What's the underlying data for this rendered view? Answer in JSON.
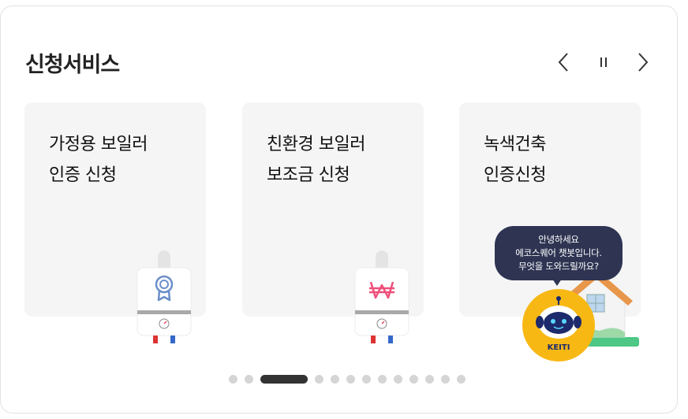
{
  "section": {
    "title": "신청서비스",
    "prev_icon": "chevron-left-icon",
    "pause_icon": "pause-icon",
    "next_icon": "chevron-right-icon"
  },
  "cards": [
    {
      "line1": "가정용 보일러",
      "line2": "인증 신청",
      "icon": "certification-ribbon-icon",
      "icon_color": "#6c8fc9"
    },
    {
      "line1": "친환경 보일러",
      "line2": "보조금 신청",
      "icon": "won-currency-icon",
      "icon_color": "#ef4f7a"
    },
    {
      "line1": "녹색건축",
      "line2": "인증신청",
      "icon": "house-icon",
      "icon_color": "#e8964a"
    }
  ],
  "pagination": {
    "count": 13,
    "active_index": 2
  },
  "chatbot": {
    "greeting_line1": "안녕하세요",
    "greeting_line2": "에코스퀘어 챗봇입니다.",
    "greeting_line3": "무엇을 도와드릴까요?",
    "brand": "KEITI",
    "colors": {
      "bubble": "#2e3452",
      "bot_bg": "#f8b814"
    }
  }
}
